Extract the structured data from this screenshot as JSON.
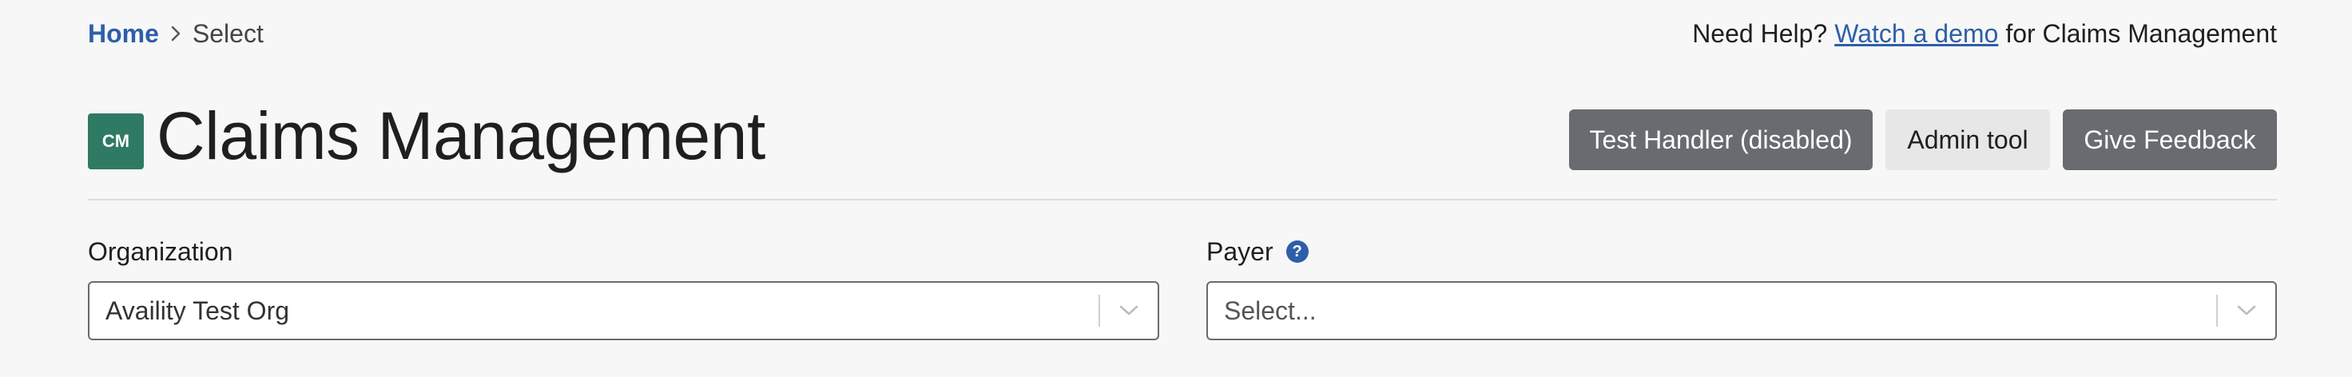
{
  "breadcrumb": {
    "home": "Home",
    "current": "Select"
  },
  "help": {
    "prefix": "Need Help?",
    "link": "Watch a demo",
    "suffix": "for Claims Management"
  },
  "header": {
    "logo_text": "CM",
    "title": "Claims Management"
  },
  "actions": {
    "test_handler": "Test Handler (disabled)",
    "admin_tool": "Admin tool",
    "give_feedback": "Give Feedback"
  },
  "form": {
    "organization": {
      "label": "Organization",
      "value": "Availity Test Org"
    },
    "payer": {
      "label": "Payer",
      "help_icon": "?",
      "placeholder": "Select..."
    }
  },
  "colors": {
    "link": "#2e5ea8",
    "logo_bg": "#2f7a63",
    "dark_button": "#686b70",
    "light_button": "#e7e7e7",
    "background": "#f7f7f7"
  },
  "icons": {
    "breadcrumb_separator": "chevron-right-icon",
    "select_arrow": "chevron-down-icon",
    "payer_help": "question-circle-icon"
  }
}
